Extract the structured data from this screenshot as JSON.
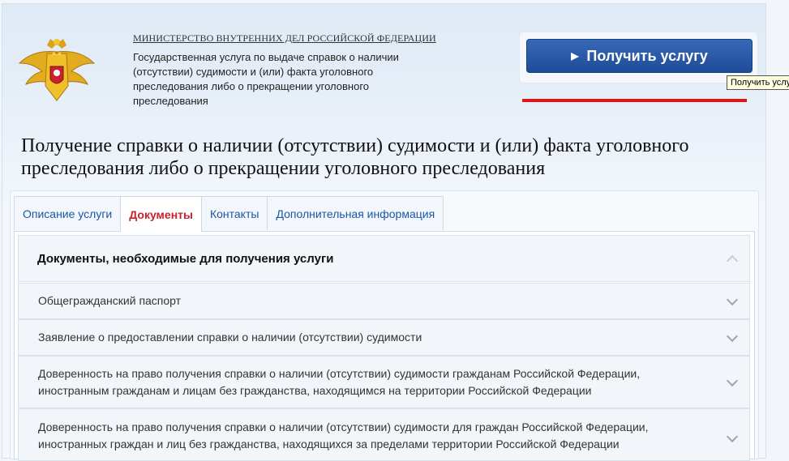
{
  "header": {
    "ministry": "МИНИСТЕРСТВО ВНУТРЕННИХ ДЕЛ РОССИЙСКОЙ ФЕДЕРАЦИИ",
    "service_description": "Государственная услуга по выдаче справок о наличии (отсутствии) судимости и (или) факта уголовного преследования либо о прекращении уголовного преследования"
  },
  "action": {
    "get_service_label": "Получить услугу",
    "tooltip": "Получить услугу",
    "accent_color": "#e0141a",
    "button_color": "#2a5aa8"
  },
  "page_title": "Получение справки о наличии (отсутствии) судимости и (или) факта уголовного преследования либо о прекращении уголовного преследования",
  "tabs": [
    {
      "label": "Описание услуги",
      "active": false
    },
    {
      "label": "Документы",
      "active": true
    },
    {
      "label": "Контакты",
      "active": false
    },
    {
      "label": "Дополнительная информация",
      "active": false
    }
  ],
  "documents": {
    "heading": "Документы, необходимые для получения услуги",
    "items": [
      {
        "label": "Общегражданский паспорт"
      },
      {
        "label": "Заявление о предоставлении справки о наличии (отсутствии) судимости"
      },
      {
        "label": "Доверенность на право получения справки о наличии (отсутствии) судимости гражданам Российской Федерации, иностранным гражданам и лицам без гражданства, находящимся на территории Российской Федерации"
      },
      {
        "label": "Доверенность на право получения справки о наличии (отсутствии) судимости для граждан Российской Федерации, иностранных граждан и лиц без гражданства, находящихся за пределами территории Российской Федерации"
      }
    ]
  },
  "icons": {
    "emblem": "mvd-emblem-icon",
    "button_arrow": "triangle-right-icon",
    "expand": "chevron-down-icon",
    "collapse": "chevron-up-icon"
  }
}
